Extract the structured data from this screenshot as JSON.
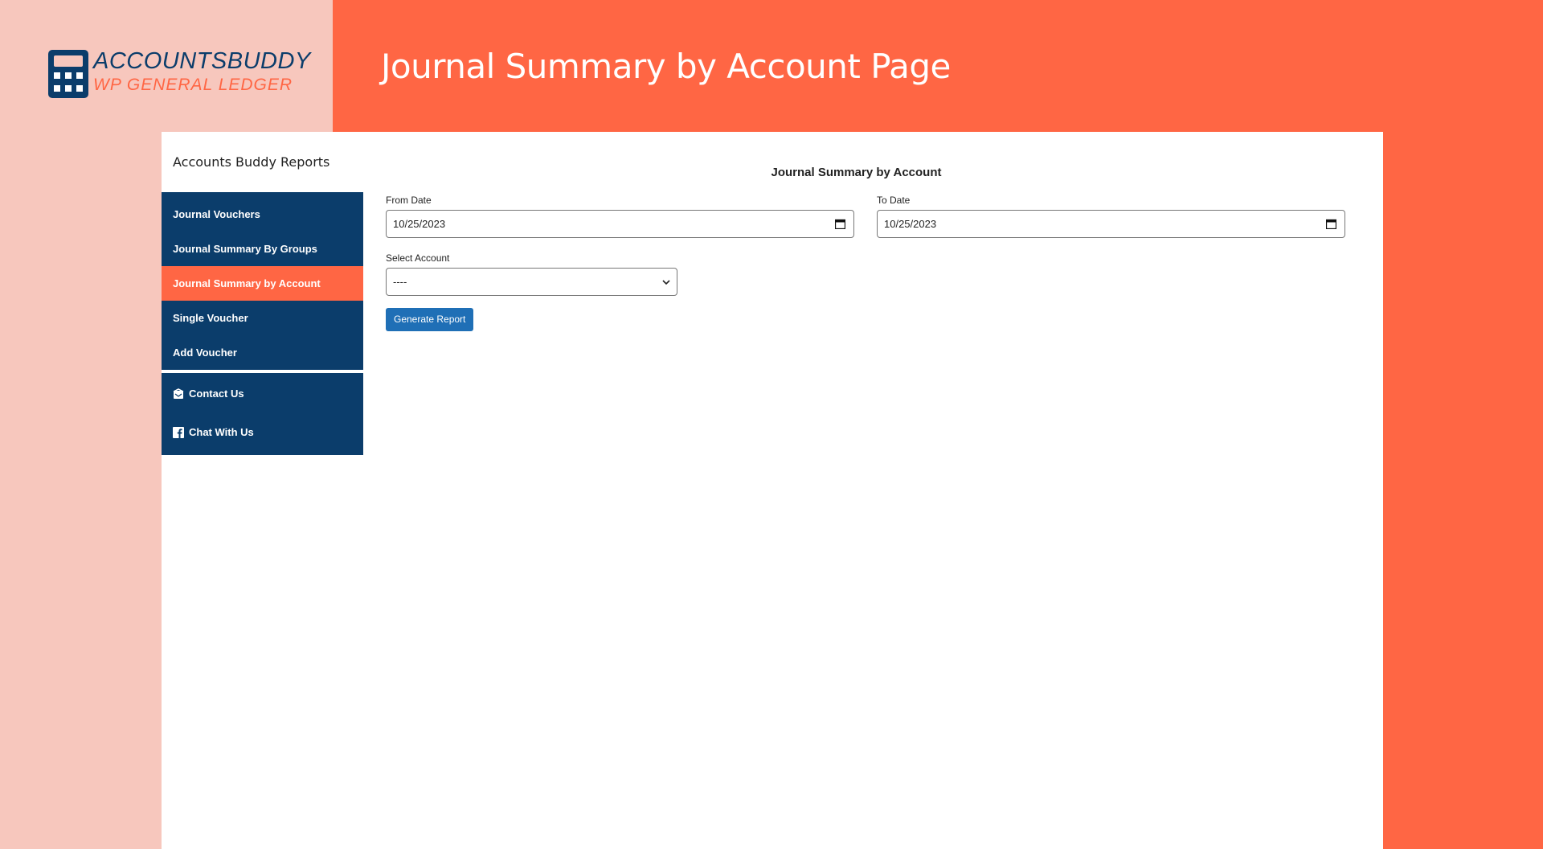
{
  "brand": {
    "name": "ACCOUNTSBUDDY",
    "subtitle": "WP GENERAL LEDGER",
    "icon": "calculator-icon"
  },
  "header": {
    "title": "Journal Summary by Account Page"
  },
  "colors": {
    "accent": "#ff6644",
    "navy": "#0b3d6b",
    "button": "#1f6fb6",
    "left_bg": "#f7c7bd"
  },
  "sidebar": {
    "title": "Accounts Buddy Reports",
    "items": [
      {
        "label": "Journal Vouchers",
        "active": false
      },
      {
        "label": "Journal Summary By Groups",
        "active": false
      },
      {
        "label": "Journal Summary by Account",
        "active": true
      },
      {
        "label": "Single Voucher",
        "active": false
      },
      {
        "label": "Add Voucher",
        "active": false
      }
    ],
    "extra": [
      {
        "label": "Contact Us",
        "icon": "contact-icon"
      },
      {
        "label": "Chat With Us",
        "icon": "facebook-icon"
      }
    ]
  },
  "form": {
    "title": "Journal Summary by Account",
    "from_label": "From Date",
    "from_value": "10/25/2023",
    "to_label": "To Date",
    "to_value": "10/25/2023",
    "account_label": "Select Account",
    "account_value": "----",
    "button_label": "Generate Report"
  }
}
